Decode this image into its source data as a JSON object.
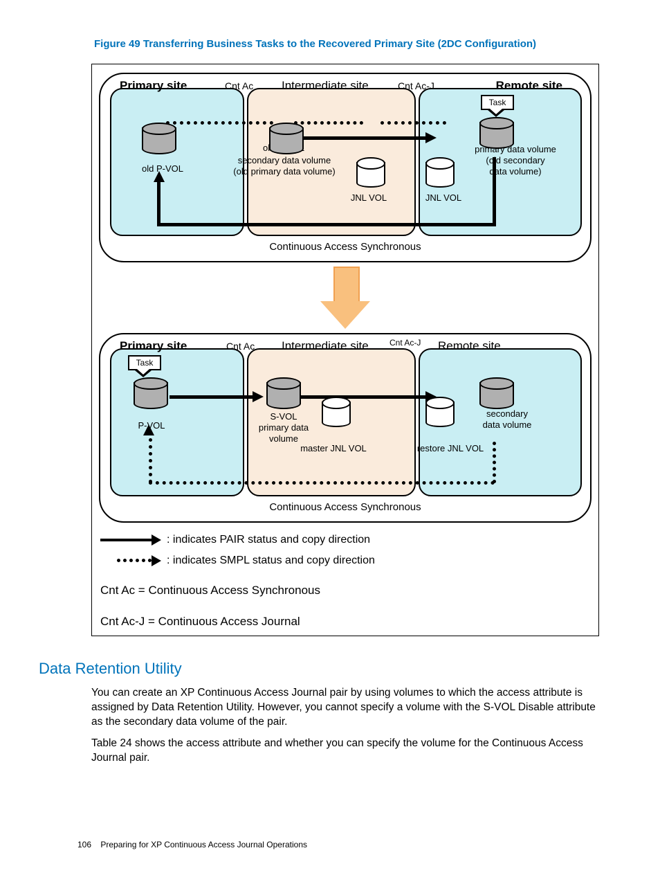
{
  "figure_caption": "Figure 49 Transferring Business Tasks to the Recovered Primary Site (2DC Configuration)",
  "panel_top": {
    "primary_title": "Primary site",
    "intermediate_title": "Intermediate site",
    "remote_title": "Remote site",
    "cntac": "Cnt Ac",
    "cntacj": "Cnt Ac-J",
    "task": "Task",
    "old_pvol": "old P-VOL",
    "old_svol": "old S-VOL",
    "sec_data_vol": "secondary data volume",
    "old_primary": "(old primary data volume)",
    "jnl_vol_l": "JNL VOL",
    "jnl_vol_r": "JNL VOL",
    "prim_data_vol": "primary data volume",
    "old_sec": "(old secondary",
    "data_vol": "data volume)",
    "footer": "Continuous Access Synchronous"
  },
  "panel_bottom": {
    "primary_title": "Primary site",
    "intermediate_title": "Intermediate site",
    "remote_title": "Remote site",
    "cntac": "Cnt Ac",
    "cntacj": "Cnt Ac-J",
    "task": "Task",
    "pvol": "P-VOL",
    "svol": "S-VOL",
    "primary_data": "primary data",
    "volume": "volume",
    "master_jnl": "master JNL VOL",
    "secondary_r": "secondary",
    "data_vol_r": "data volume",
    "restore_jnl": "restore JNL VOL",
    "footer": "Continuous Access Synchronous"
  },
  "legend": {
    "pair": ": indicates PAIR status and copy direction",
    "smpl": ": indicates SMPL status and copy direction",
    "cntac": "Cnt Ac = Continuous Access Synchronous",
    "cntacj": "Cnt Ac-J = Continuous Access Journal"
  },
  "heading": "Data Retention Utility",
  "para1": "You can create an XP Continuous Access Journal pair by using volumes to which the access attribute is assigned by Data Retention Utility. However, you cannot specify a volume with the S-VOL Disable attribute as the secondary data volume of the pair.",
  "para2": "Table 24 shows the access attribute and whether you can specify the volume for the Continuous Access Journal pair.",
  "footer_page": "106",
  "footer_text": "Preparing for XP Continuous Access Journal Operations"
}
